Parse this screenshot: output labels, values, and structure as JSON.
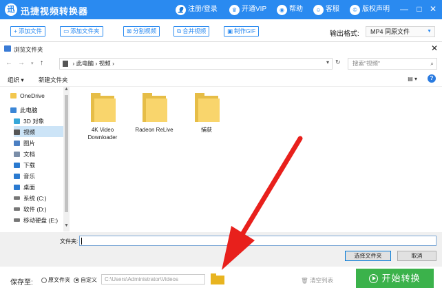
{
  "app": {
    "title": "迅捷视频转换器",
    "logo_text": "迅"
  },
  "titlebar": {
    "register_login": "注册/登录",
    "vip": "开通VIP",
    "help": "帮助",
    "support": "客服",
    "copyright": "版权声明",
    "minimize": "—",
    "maximize": "□",
    "close": "✕"
  },
  "toolbar": {
    "add_file": "添加文件",
    "add_folder": "添加文件夹",
    "split_video": "分割视频",
    "merge_video": "合并视频",
    "make_gif": "制作GIF",
    "format_label": "输出格式:",
    "format_value": "MP4  同原文件"
  },
  "dialog": {
    "title": "浏览文件夹",
    "path": [
      "此电脑",
      "视频"
    ],
    "search_placeholder": "搜索\"视频\"",
    "organize": "组织 ▾",
    "new_folder": "新建文件夹",
    "nav_items": [
      {
        "label": "OneDrive",
        "icon": "onedrive-folder-icon",
        "color": "#f3c74e"
      },
      {
        "label": "此电脑",
        "icon": "computer-icon",
        "color": "#3a86d6"
      },
      {
        "label": "3D 对象",
        "icon": "3d-objects-icon",
        "color": "#35a7d9"
      },
      {
        "label": "视频",
        "icon": "video-folder-icon",
        "color": "#555555"
      },
      {
        "label": "图片",
        "icon": "pictures-icon",
        "color": "#4b7fc2"
      },
      {
        "label": "文档",
        "icon": "documents-icon",
        "color": "#7a8ea8"
      },
      {
        "label": "下载",
        "icon": "downloads-icon",
        "color": "#2a7ad0"
      },
      {
        "label": "音乐",
        "icon": "music-icon",
        "color": "#2a7ad0"
      },
      {
        "label": "桌面",
        "icon": "desktop-icon",
        "color": "#2a7ad0"
      },
      {
        "label": "系统 (C:)",
        "icon": "drive-icon",
        "color": "#777777"
      },
      {
        "label": "软件 (D:)",
        "icon": "drive-icon",
        "color": "#777777"
      },
      {
        "label": "移动硬盘 (E:)",
        "icon": "drive-icon",
        "color": "#777777"
      }
    ],
    "folders": [
      "4K Video Downloader",
      "Radeon ReLive",
      "捕获"
    ],
    "filename_label": "文件夹:",
    "filename_value": "",
    "select_button": "选择文件夹",
    "cancel_button": "取消"
  },
  "bottom": {
    "save_label": "保存至:",
    "radio_original": "原文件夹",
    "radio_custom": "自定义",
    "custom_selected": true,
    "path": "C:\\Users\\Administrator\\Videos",
    "clear_list": "清空列表",
    "start": "开始转换"
  },
  "colors": {
    "brand": "#2a8af0",
    "start": "#3bb24b",
    "annotation_arrow": "#e8201c"
  }
}
